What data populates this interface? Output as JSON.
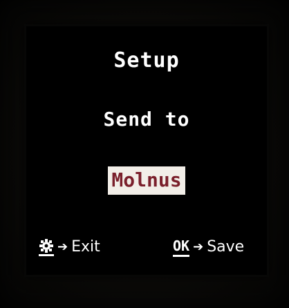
{
  "menu": {
    "title": "Setup",
    "subtitle": "Send to",
    "selected_option": "Molnus"
  },
  "footer": {
    "exit_hint": {
      "key_icon": "gear-icon",
      "arrow": "➔",
      "label": "Exit"
    },
    "save_hint": {
      "key_label": "OK",
      "arrow": "➔",
      "label": "Save"
    }
  },
  "colors": {
    "screen_bg": "#000000",
    "text": "#ffffff",
    "highlight_bg": "#f2eee8",
    "highlight_text": "#7a1f2b"
  }
}
